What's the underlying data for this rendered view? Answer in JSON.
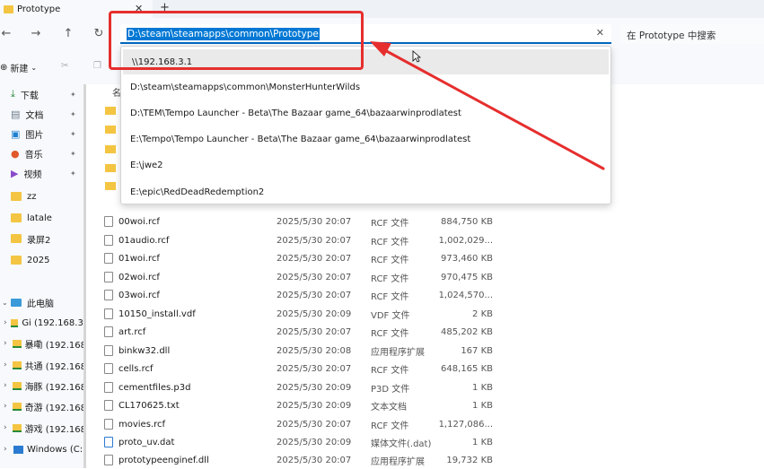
{
  "window": {
    "tab_title": "Prototype"
  },
  "address": {
    "current_path": "D:\\steam\\steamapps\\common\\Prototype",
    "search_placeholder": "在 Prototype 中搜索"
  },
  "toolbar": {
    "new_label": "新建"
  },
  "column_header": "名",
  "sidebar": {
    "quick_access": [
      {
        "label": "下载",
        "icon": "download-icon",
        "pinned": true
      },
      {
        "label": "文档",
        "icon": "document-icon",
        "pinned": true
      },
      {
        "label": "图片",
        "icon": "picture-icon",
        "pinned": true
      },
      {
        "label": "音乐",
        "icon": "music-icon",
        "pinned": true
      },
      {
        "label": "视频",
        "icon": "video-icon",
        "pinned": true
      },
      {
        "label": "zz",
        "icon": "folder-icon",
        "pinned": false
      },
      {
        "label": "latale",
        "icon": "folder-icon",
        "pinned": false
      },
      {
        "label": "录屏2",
        "icon": "folder-icon",
        "pinned": false
      },
      {
        "label": "2025",
        "icon": "folder-icon",
        "pinned": false
      }
    ],
    "this_pc": "此电脑",
    "drives": [
      {
        "label": "Gi (192.168.3."
      },
      {
        "label": "暴嘞 (192.168"
      },
      {
        "label": "共通 (192.168"
      },
      {
        "label": "海豚 (192.168"
      },
      {
        "label": "奇游 (192.168"
      },
      {
        "label": "游戏 (192.168"
      },
      {
        "label": "Windows (C:)"
      }
    ]
  },
  "autocomplete": [
    "\\\\192.168.3.1",
    "D:\\steam\\steamapps\\common\\MonsterHunterWilds",
    "D:\\TEM\\Tempo Launcher - Beta\\The Bazaar game_64\\bazaarwinprodlatest",
    "E:\\Tempo\\Tempo Launcher - Beta\\The Bazaar game_64\\bazaarwinprodlatest",
    "E:\\jwe2",
    "E:\\epic\\RedDeadRedemption2"
  ],
  "files": [
    {
      "name": "00woi.rcf",
      "date": "2025/5/30 20:07",
      "type": "RCF 文件",
      "size": "884,750 KB"
    },
    {
      "name": "01audio.rcf",
      "date": "2025/5/30 20:07",
      "type": "RCF 文件",
      "size": "1,002,029..."
    },
    {
      "name": "01woi.rcf",
      "date": "2025/5/30 20:07",
      "type": "RCF 文件",
      "size": "973,460 KB"
    },
    {
      "name": "02woi.rcf",
      "date": "2025/5/30 20:07",
      "type": "RCF 文件",
      "size": "970,475 KB"
    },
    {
      "name": "03woi.rcf",
      "date": "2025/5/30 20:07",
      "type": "RCF 文件",
      "size": "1,024,570..."
    },
    {
      "name": "10150_install.vdf",
      "date": "2025/5/30 20:09",
      "type": "VDF 文件",
      "size": "2 KB"
    },
    {
      "name": "art.rcf",
      "date": "2025/5/30 20:07",
      "type": "RCF 文件",
      "size": "485,202 KB"
    },
    {
      "name": "binkw32.dll",
      "date": "2025/5/30 20:08",
      "type": "应用程序扩展",
      "size": "167 KB"
    },
    {
      "name": "cells.rcf",
      "date": "2025/5/30 20:07",
      "type": "RCF 文件",
      "size": "648,165 KB"
    },
    {
      "name": "cementfiles.p3d",
      "date": "2025/5/30 20:09",
      "type": "P3D 文件",
      "size": "1 KB"
    },
    {
      "name": "CL170625.txt",
      "date": "2025/5/30 20:09",
      "type": "文本文档",
      "size": "1 KB"
    },
    {
      "name": "movies.rcf",
      "date": "2025/5/30 20:07",
      "type": "RCF 文件",
      "size": "1,127,086..."
    },
    {
      "name": "proto_uv.dat",
      "date": "2025/5/30 20:09",
      "type": "媒体文件(.dat)",
      "size": "1 KB"
    },
    {
      "name": "prototypeenginef.dll",
      "date": "2025/5/30 20:07",
      "type": "应用程序扩展",
      "size": "19,732 KB"
    }
  ],
  "colors": {
    "accent": "#0078d4",
    "annotation": "#e62e2e",
    "folder": "#f4c542"
  }
}
